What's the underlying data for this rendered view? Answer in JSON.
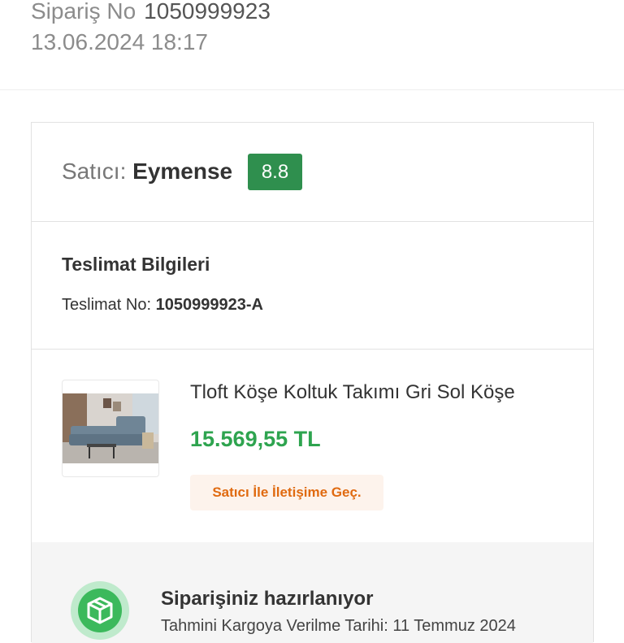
{
  "order": {
    "number_label": "Sipariş No",
    "number": "1050999923",
    "date": "13.06.2024 18:17"
  },
  "seller": {
    "label": "Satıcı:",
    "name": "Eymense",
    "rating": "8.8",
    "rating_color": "#2f8f4e"
  },
  "delivery": {
    "title": "Teslimat Bilgileri",
    "number_label": "Teslimat No:",
    "number": "1050999923-A"
  },
  "product": {
    "name": "Tloft Köşe Koltuk Takımı Gri Sol Köşe",
    "price": "15.569,55 TL",
    "price_color": "#2ea44f",
    "contact_label": "Satıcı İle İletişime Geç.",
    "image_icon": "sofa-image"
  },
  "status": {
    "title": "Siparişiniz hazırlanıyor",
    "subtitle": "Tahmini Kargoya Verilme Tarihi: 11 Temmuz 2024",
    "icon": "package-icon"
  }
}
